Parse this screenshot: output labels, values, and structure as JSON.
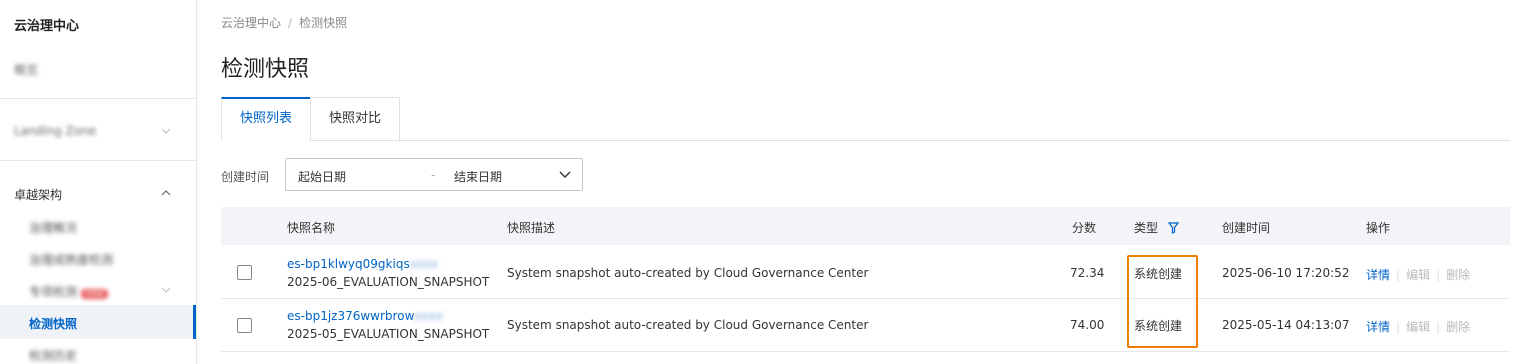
{
  "sidebar": {
    "title": "云治理中心",
    "overview": "概览",
    "landing_zone": "Landing Zone",
    "section": "卓越架构",
    "sub_items": [
      "治理概况",
      "治理成熟度检测",
      "专项检测",
      "检测快照",
      "检测历史"
    ],
    "sub_badge": "new",
    "active_label": "检测快照"
  },
  "breadcrumb": {
    "root": "云治理中心",
    "current": "检测快照"
  },
  "page_title": "检测快照",
  "tabs": [
    {
      "label": "快照列表"
    },
    {
      "label": "快照对比"
    }
  ],
  "filter": {
    "label": "创建时间",
    "start_placeholder": "起始日期",
    "separator": "-",
    "end_placeholder": "结束日期"
  },
  "table": {
    "headers": {
      "name": "快照名称",
      "desc": "快照描述",
      "score": "分数",
      "type": "类型",
      "created": "创建时间",
      "ops": "操作"
    },
    "rows": [
      {
        "id_visible": "es-bp1klwyq09gkiqs",
        "id_hidden": "xxxx",
        "name": "2025-06_EVALUATION_SNAPSHOT",
        "desc": "System snapshot auto-created by Cloud Governance Center",
        "score": "72.34",
        "type": "系统创建",
        "created": "2025-06-10 17:20:52",
        "op_detail": "详情",
        "op_edit": "编辑",
        "op_delete": "删除"
      },
      {
        "id_visible": "es-bp1jz376wwrbrow",
        "id_hidden": "xxxx",
        "name": "2025-05_EVALUATION_SNAPSHOT",
        "desc": "System snapshot auto-created by Cloud Governance Center",
        "score": "74.00",
        "type": "系统创建",
        "created": "2025-05-14 04:13:07",
        "op_detail": "详情",
        "op_edit": "编辑",
        "op_delete": "删除"
      }
    ]
  },
  "colors": {
    "accent": "#0064c8",
    "highlight": "#f07d00"
  }
}
